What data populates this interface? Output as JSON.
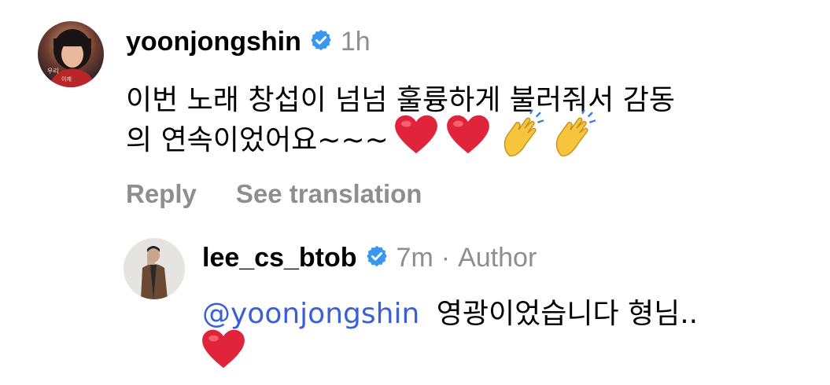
{
  "comment": {
    "username": "yoonjongshin",
    "time": "1h",
    "text_line1": "이번 노래 창섭이 넘넘 훌륭하게 불러줘서 감동",
    "text_line2": "의 연속이었어요~~~",
    "actions": {
      "reply": "Reply",
      "translate": "See translation"
    }
  },
  "reply": {
    "username": "lee_cs_btob",
    "time": "7m",
    "separator": "·",
    "author_label": "Author",
    "mention": "@yoonjongshin",
    "text": "영광이었습니다 형님..",
    "avatar_caption": ""
  },
  "icons": {
    "verified": "verified-badge-icon",
    "heart": "red-heart-emoji",
    "clap": "clapping-hands-emoji"
  },
  "colors": {
    "verified": "#3897f0",
    "muted": "#8e8e8e",
    "mention": "#3b5fd6",
    "heart": "#e0243c",
    "clap": "#f7c43d"
  }
}
